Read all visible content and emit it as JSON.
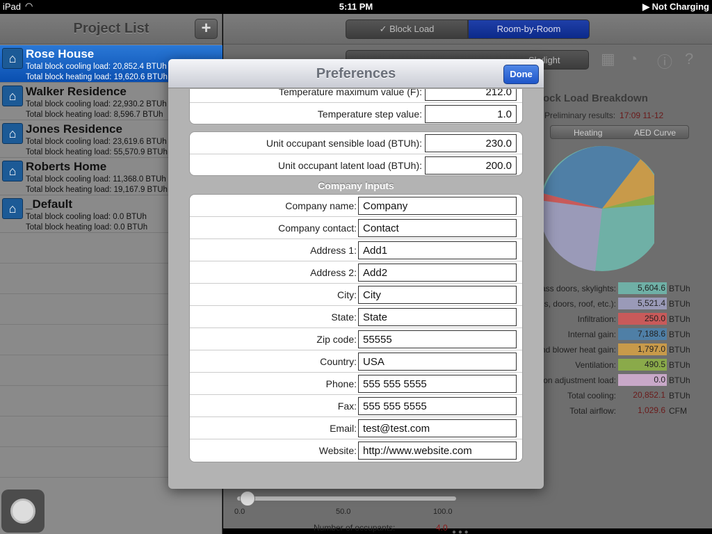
{
  "status": {
    "carrier": "iPad",
    "time": "5:11 PM",
    "battery": "▶ Not Charging"
  },
  "left": {
    "title": "Project List",
    "add_label": "+",
    "projects": [
      {
        "name": "Rose House",
        "line1": "Total block cooling load: 20,852.4 BTUh",
        "line2": "Total block heating load: 19,620.6 BTUh"
      },
      {
        "name": "Walker Residence",
        "line1": "Total block cooling load: 22,930.2 BTUh",
        "line2": "Total block heating load: 8,596.7 BTUh"
      },
      {
        "name": "Jones Residence",
        "line1": "Total block cooling load: 23,619.6 BTUh",
        "line2": "Total block heating load: 55,570.9 BTUh"
      },
      {
        "name": "Roberts Home",
        "line1": "Total block cooling load: 11,368.0 BTUh",
        "line2": "Total block heating load: 19,167.9 BTUh"
      },
      {
        "name": "_Default",
        "line1": "Total block cooling load: 0.0 BTUh",
        "line2": "Total block heating load: 0.0 BTUh"
      }
    ]
  },
  "right": {
    "seg_block": "✓ Block Load",
    "seg_room": "Room-by-Room",
    "tab_skylight": "Skylight",
    "breakdown_title": "ock Load Breakdown",
    "prelim_label": "Preliminary results:",
    "prelim_time": "17:09 11-12",
    "tab_heating": "Heating",
    "tab_aed": "AED Curve",
    "legend": [
      {
        "label": "ass doors, skylights:",
        "value": "5,604.6",
        "unit": "BTUh",
        "color": "#6fb0a6"
      },
      {
        "label": "s, doors, roof, etc.):",
        "value": "5,521.4",
        "unit": "BTUh",
        "color": "#9a9ab8"
      },
      {
        "label": "Infiltration:",
        "value": "250.0",
        "unit": "BTUh",
        "color": "#c85a5a"
      },
      {
        "label": "Internal gain:",
        "value": "7,188.6",
        "unit": "BTUh",
        "color": "#4f7fa6"
      },
      {
        "label": "nd blower heat gain:",
        "value": "1,797.0",
        "unit": "BTUh",
        "color": "#c89a4a"
      },
      {
        "label": "Ventilation:",
        "value": "490.5",
        "unit": "BTUh",
        "color": "#8aaa4a"
      },
      {
        "label": "on adjustment load:",
        "value": "0.0",
        "unit": "BTUh",
        "color": "#c8a8c8"
      },
      {
        "label": "Total cooling:",
        "value": "20,852.1",
        "unit": "BTUh",
        "color": ""
      },
      {
        "label": "Total airflow:",
        "value": "1,029.6",
        "unit": "CFM",
        "color": ""
      }
    ],
    "slider_min": "0.0",
    "slider_mid": "50.0",
    "slider_max": "100.0",
    "occupants_label": "Number of occupants:",
    "occupants_value": "4.0"
  },
  "modal": {
    "title": "Preferences",
    "done_label": "Done",
    "temp_rows": [
      {
        "label": "Temperature maximum value (F):",
        "value": "212.0"
      },
      {
        "label": "Temperature step value:",
        "value": "1.0"
      }
    ],
    "occupant_rows": [
      {
        "label": "Unit occupant sensible load (BTUh):",
        "value": "230.0"
      },
      {
        "label": "Unit occupant latent load (BTUh):",
        "value": "200.0"
      }
    ],
    "company_header": "Company Inputs",
    "company_rows": [
      {
        "label": "Company name:",
        "value": "Company"
      },
      {
        "label": "Company contact:",
        "value": "Contact"
      },
      {
        "label": "Address 1:",
        "value": "Add1"
      },
      {
        "label": "Address 2:",
        "value": "Add2"
      },
      {
        "label": "City:",
        "value": "City"
      },
      {
        "label": "State:",
        "value": "State"
      },
      {
        "label": "Zip code:",
        "value": "55555"
      },
      {
        "label": "Country:",
        "value": "USA"
      },
      {
        "label": "Phone:",
        "value": "555 555 5555"
      },
      {
        "label": "Fax:",
        "value": "555 555 5555"
      },
      {
        "label": "Email:",
        "value": "test@test.com"
      },
      {
        "label": "Website:",
        "value": "http://www.website.com"
      }
    ]
  }
}
